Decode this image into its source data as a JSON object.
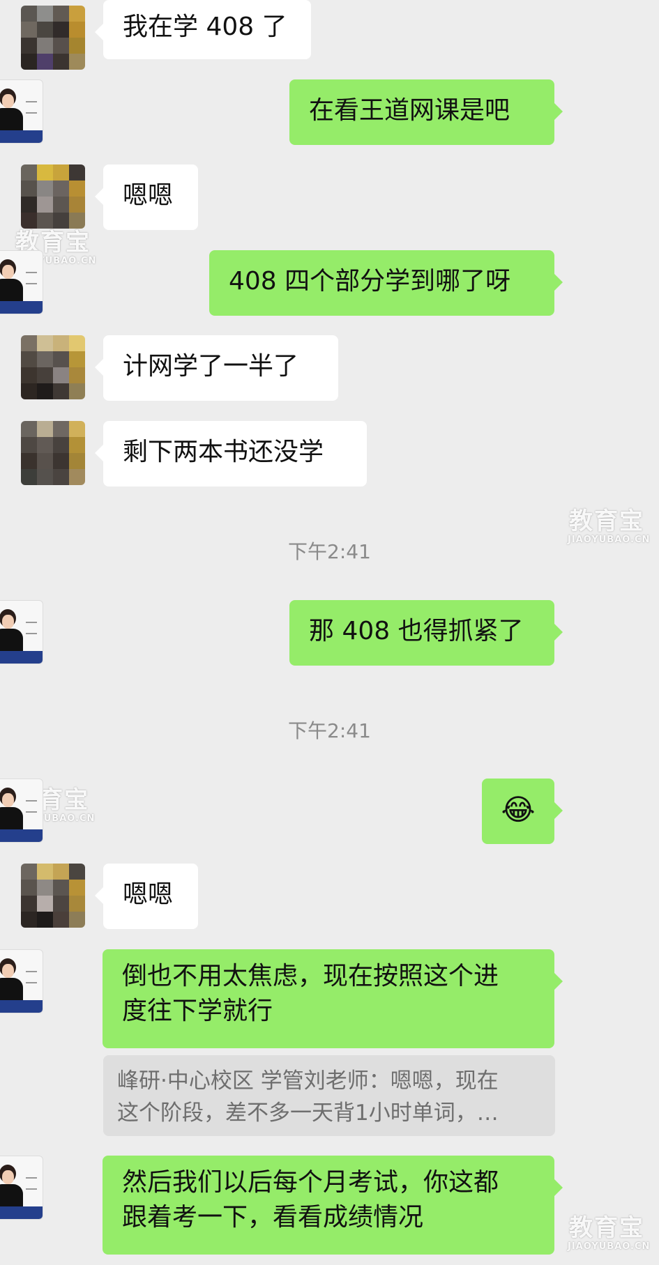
{
  "chat": {
    "messages": [
      {
        "side": "left",
        "text": "我在学 408 了"
      },
      {
        "side": "right",
        "text": "在看王道网课是吧"
      },
      {
        "side": "left",
        "text": "嗯嗯"
      },
      {
        "side": "right",
        "text": "408 四个部分学到哪了呀"
      },
      {
        "side": "left",
        "text": "计网学了一半了"
      },
      {
        "side": "left",
        "text": "剩下两本书还没学"
      },
      {
        "side": "right",
        "text": "那 408 也得抓紧了"
      },
      {
        "side": "right",
        "text": "😂",
        "emoji": "tears-of-joy"
      },
      {
        "side": "left",
        "text": "嗯嗯"
      },
      {
        "side": "right",
        "lines": [
          "倒也不用太焦虑，现在按照这个进",
          "度往下学就行"
        ]
      },
      {
        "side": "right",
        "lines": [
          "然后我们以后每个月考试，你这都",
          "跟着考一下，看看成绩情况"
        ]
      }
    ],
    "timestamps": [
      "下午2:41",
      "下午2:41"
    ],
    "quote": {
      "lines": [
        "峰研·中心校区 学管刘老师：嗯嗯，现在",
        "这个阶段，差不多一天背1小时单词，…"
      ]
    }
  },
  "watermark": {
    "cn": "教育宝",
    "en": "JIAOYUBAO.CN"
  },
  "colors": {
    "background": "#ededed",
    "bubble_self": "#95ec69",
    "bubble_other": "#ffffff",
    "quote_bg": "#dedede",
    "timestamp": "#8a8a8a"
  }
}
